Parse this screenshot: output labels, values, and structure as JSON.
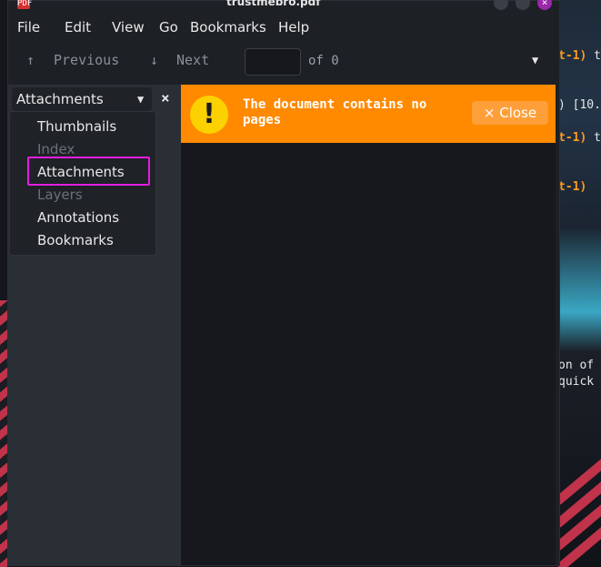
{
  "window": {
    "title": "trustmebro.pdf",
    "app_icon_label": "PDF"
  },
  "menubar": {
    "items": [
      "File",
      "Edit",
      "View",
      "Go",
      "Bookmarks",
      "Help"
    ]
  },
  "toolbar": {
    "previous_label": "Previous",
    "next_label": "Next",
    "page_input_value": "",
    "page_of_label": "of 0"
  },
  "sidebar": {
    "selected": "Attachments",
    "popup_items": [
      {
        "label": "Thumbnails",
        "enabled": true
      },
      {
        "label": "Index",
        "enabled": false
      },
      {
        "label": "Attachments",
        "enabled": true
      },
      {
        "label": "Layers",
        "enabled": false
      },
      {
        "label": "Annotations",
        "enabled": true
      },
      {
        "label": "Bookmarks",
        "enabled": true
      }
    ]
  },
  "infobar": {
    "message": "The document contains no pages",
    "close_label": "Close",
    "color": "#ff8a00"
  },
  "background_terminal": {
    "lines": [
      {
        "text": "t-1) t",
        "orange_part": "t-1)"
      },
      {
        "text": ") [10.",
        "orange_part": ""
      },
      {
        "text": "t-1) t",
        "orange_part": "t-1)"
      },
      {
        "text": "t-1)",
        "orange_part": "t-1)"
      },
      {
        "text": "on of",
        "orange_part": ""
      },
      {
        "text": " quick",
        "orange_part": ""
      }
    ]
  },
  "colors": {
    "highlight": "#e31de0",
    "accent_orange": "#ff8a00",
    "warning_yellow": "#fcd100"
  }
}
